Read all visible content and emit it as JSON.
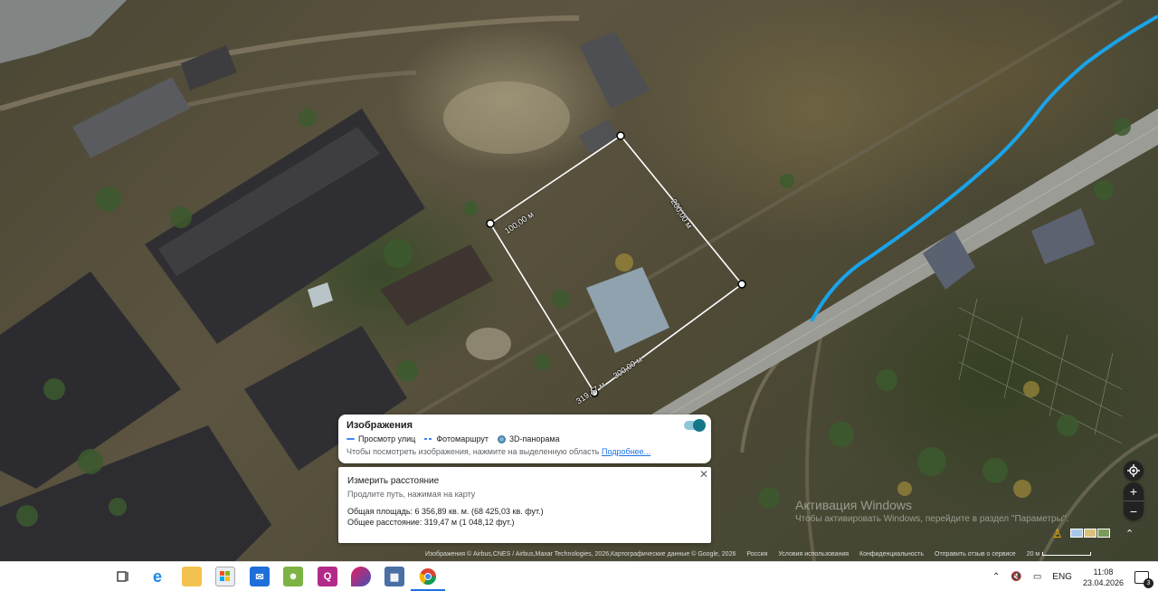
{
  "map": {
    "segments": [
      {
        "label": "100,00 м"
      },
      {
        "label": "200,00 м"
      },
      {
        "label": "300,00 м"
      },
      {
        "label": "319,47 м"
      }
    ]
  },
  "imagery": {
    "title": "Изображения",
    "legend": [
      "Просмотр улиц",
      "Фотомаршрут",
      "3D-панорама"
    ],
    "hint": "Чтобы посмотреть изображения, нажмите на выделенную область",
    "more_link": "Подробнее..."
  },
  "measure": {
    "title": "Измерить расстояние",
    "subtitle": "Продлите путь, нажимая на карту",
    "area": "Общая площадь: 6 356,89 кв. м. (68 425,03 кв. фут.)",
    "distance": "Общее расстояние: 319,47 м (1 048,12 фут.)"
  },
  "watermark": {
    "line1": "Активация Windows",
    "line2": "Чтобы активировать Windows, перейдите в раздел \"Параметры\"."
  },
  "attribution": {
    "imagery": "Изображения © Airbus,CNES / Airbus,Maxar Technologies, 2026,Картографические данные © Google, 2026",
    "country": "Россия",
    "terms": "Условия использования",
    "privacy": "Конфиденциальность",
    "feedback": "Отправить отзыв о сервисе",
    "scale": "20 м"
  },
  "taskbar": {
    "lang": "ENG",
    "time": "11:08",
    "date": "23.04.2026",
    "notifications": "3"
  },
  "colors": {
    "route": "#1aa3e8",
    "accent": "#1a73e8",
    "measure_line": "#ffffff"
  }
}
